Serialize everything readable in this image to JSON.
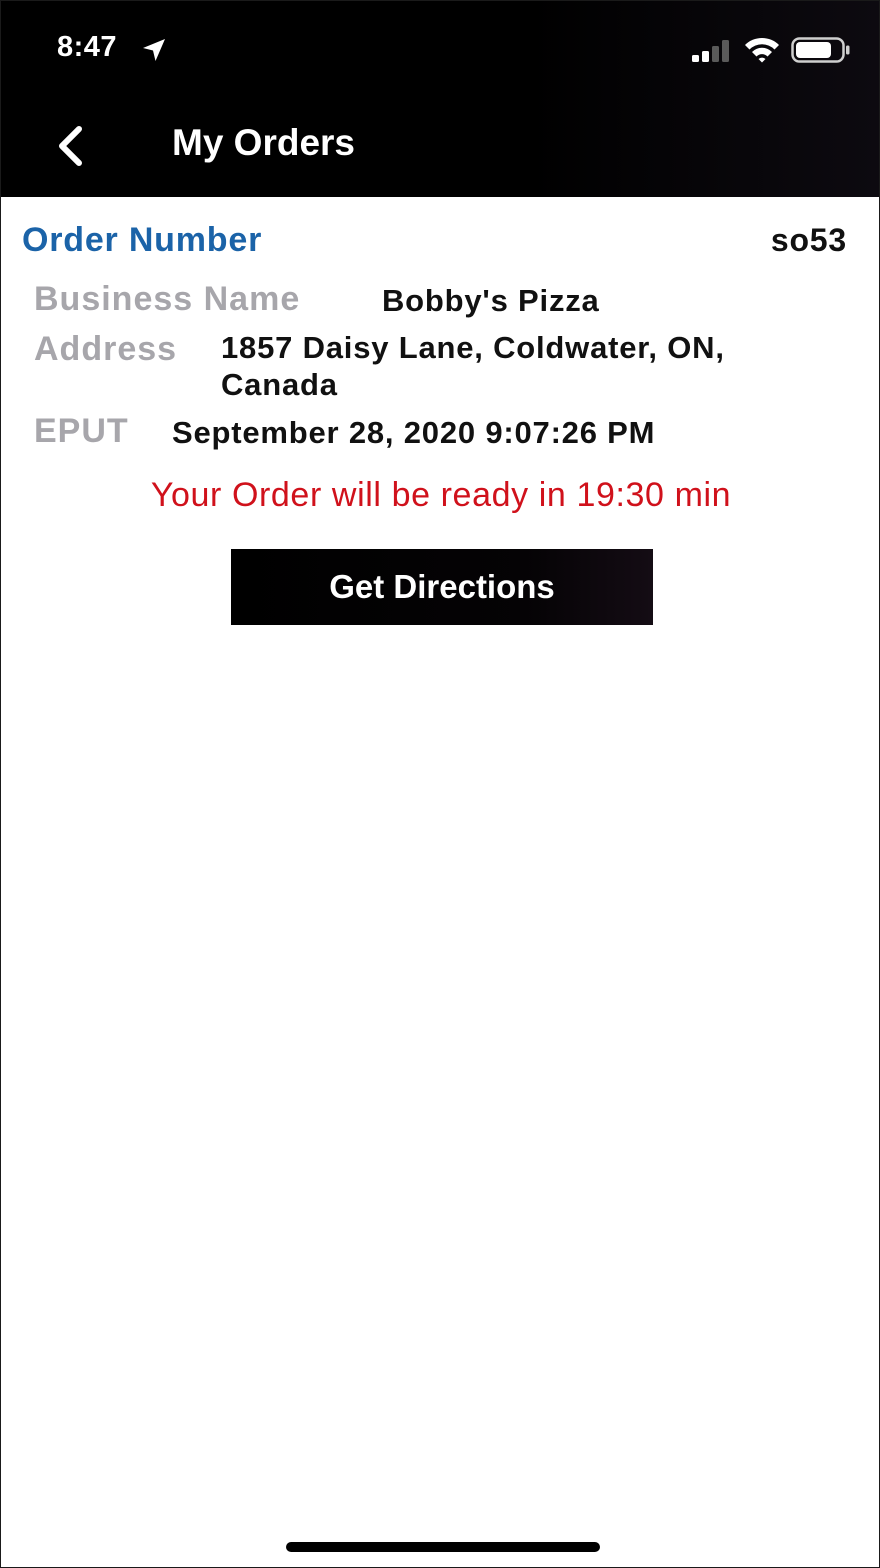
{
  "status_bar": {
    "time": "8:47"
  },
  "nav": {
    "title": "My Orders"
  },
  "order": {
    "number_label": "Order Number",
    "number_value": "so53",
    "business_name_label": "Business Name",
    "business_name_value": "Bobby's Pizza",
    "address_label": "Address",
    "address_line1": "1857 Daisy Lane, Coldwater, ON,",
    "address_line2": "Canada",
    "eput_label": "EPUT",
    "eput_value": "September 28, 2020 9:07:26 PM",
    "ready_message": "Your Order will be ready in 19:30 min",
    "directions_button": "Get Directions"
  },
  "colors": {
    "accent_blue": "#1b63a8",
    "alert_red": "#d0111b",
    "label_gray": "#a7a6ab",
    "bar_black": "#000000"
  },
  "icons": {
    "back": "chevron-left-icon",
    "location": "location-arrow-icon",
    "signal": "cellular-signal-icon",
    "wifi": "wifi-icon",
    "battery": "battery-icon"
  }
}
